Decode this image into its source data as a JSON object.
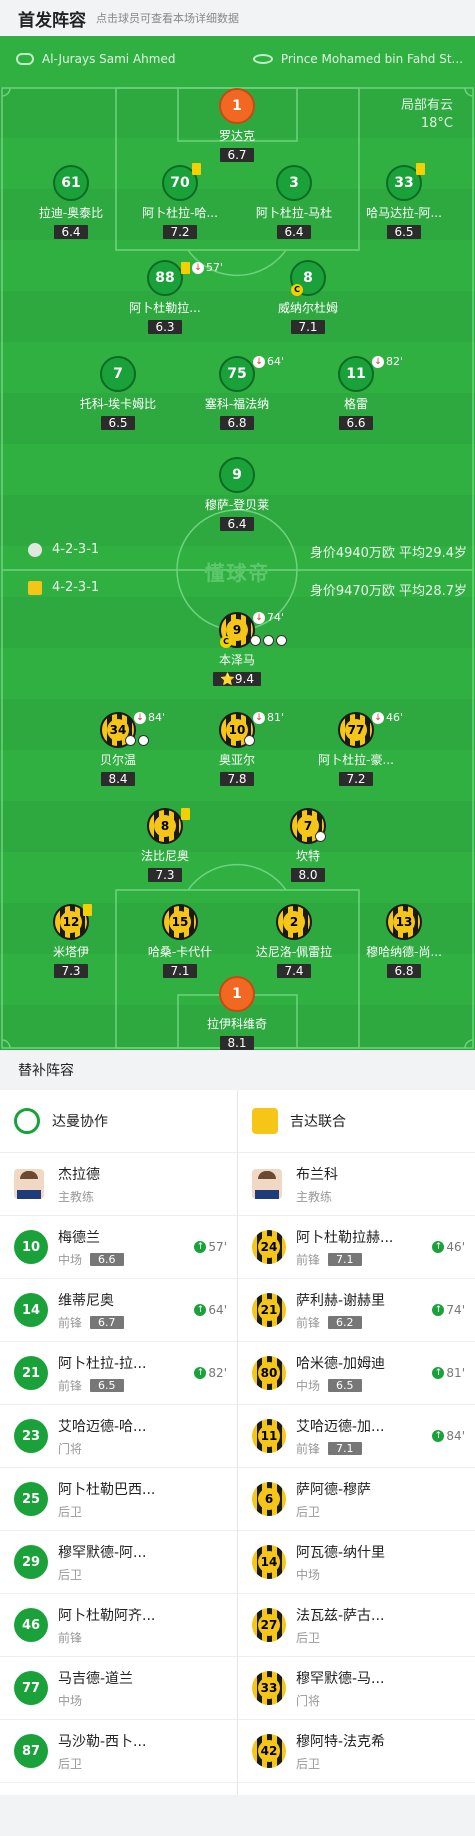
{
  "header": {
    "title": "首发阵容",
    "subtitle": "点击球员可查看本场详细数据"
  },
  "home_team": {
    "name": "Al-Jurays Sami Ahmed",
    "formation": "4-2-3-1",
    "value_text": "身价4940万欧 平均29.4岁"
  },
  "away_team": {
    "name": "Prince Mohamed bin Fahd St...",
    "formation": "4-2-3-1",
    "value_text": "身价9470万欧 平均28.7岁"
  },
  "weather": {
    "condition": "局部有云",
    "temp": "18°C"
  },
  "watermark": "懂球帝",
  "home_players": [
    {
      "num": "1",
      "name": "罗达克",
      "rating": "6.7"
    },
    {
      "num": "61",
      "name": "拉迪-奥泰比",
      "rating": "6.4"
    },
    {
      "num": "70",
      "name": "阿卜杜拉-哈...",
      "rating": "7.2"
    },
    {
      "num": "3",
      "name": "阿卜杜拉-马杜",
      "rating": "6.4"
    },
    {
      "num": "33",
      "name": "哈马达拉-阿...",
      "rating": "6.5"
    },
    {
      "num": "88",
      "name": "阿卜杜勒拉...",
      "rating": "6.3",
      "sub": "57'"
    },
    {
      "num": "8",
      "name": "威纳尔杜姆",
      "rating": "7.1"
    },
    {
      "num": "7",
      "name": "托科-埃卡姆比",
      "rating": "6.5"
    },
    {
      "num": "75",
      "name": "塞科-福法纳",
      "rating": "6.8",
      "sub": "64'"
    },
    {
      "num": "11",
      "name": "格雷",
      "rating": "6.6",
      "sub": "82'"
    },
    {
      "num": "9",
      "name": "穆萨-登贝莱",
      "rating": "6.4"
    }
  ],
  "away_players": [
    {
      "num": "9",
      "name": "本泽马",
      "rating": "9.4",
      "sub": "74'"
    },
    {
      "num": "34",
      "name": "贝尔温",
      "rating": "8.4",
      "sub": "84'"
    },
    {
      "num": "10",
      "name": "奥亚尔",
      "rating": "7.8",
      "sub": "81'"
    },
    {
      "num": "77",
      "name": "阿卜杜拉-豪...",
      "rating": "7.2",
      "sub": "46'"
    },
    {
      "num": "8",
      "name": "法比尼奥",
      "rating": "7.3"
    },
    {
      "num": "7",
      "name": "坎特",
      "rating": "8.0"
    },
    {
      "num": "12",
      "name": "米塔伊",
      "rating": "7.3"
    },
    {
      "num": "15",
      "name": "哈桑-卡代什",
      "rating": "7.1"
    },
    {
      "num": "2",
      "name": "达尼洛-佩雷拉",
      "rating": "7.4"
    },
    {
      "num": "13",
      "name": "穆哈纳德-尚...",
      "rating": "6.8"
    },
    {
      "num": "1",
      "name": "拉伊科维奇",
      "rating": "8.1"
    }
  ],
  "subs": {
    "title": "替补阵容",
    "home": {
      "team_name": "达曼协作",
      "coach": {
        "name": "杰拉德",
        "role": "主教练"
      },
      "players": [
        {
          "num": "10",
          "name": "梅德兰",
          "pos": "中场",
          "rating": "6.6",
          "min": "57'"
        },
        {
          "num": "14",
          "name": "维蒂尼奥",
          "pos": "前锋",
          "rating": "6.7",
          "min": "64'"
        },
        {
          "num": "21",
          "name": "阿卜杜拉-拉...",
          "pos": "前锋",
          "rating": "6.5",
          "min": "82'"
        },
        {
          "num": "23",
          "name": "艾哈迈德-哈...",
          "pos": "门将"
        },
        {
          "num": "25",
          "name": "阿卜杜勒巴西...",
          "pos": "后卫"
        },
        {
          "num": "29",
          "name": "穆罕默德-阿...",
          "pos": "后卫"
        },
        {
          "num": "46",
          "name": "阿卜杜勒阿齐...",
          "pos": "前锋"
        },
        {
          "num": "77",
          "name": "马吉德-道兰",
          "pos": "中场"
        },
        {
          "num": "87",
          "name": "马沙勒-西卜...",
          "pos": "后卫"
        }
      ]
    },
    "away": {
      "team_name": "吉达联合",
      "coach": {
        "name": "布兰科",
        "role": "主教练"
      },
      "players": [
        {
          "num": "24",
          "name": "阿卜杜勒拉赫...",
          "pos": "前锋",
          "rating": "7.1",
          "min": "46'"
        },
        {
          "num": "21",
          "name": "萨利赫-谢赫里",
          "pos": "前锋",
          "rating": "6.2",
          "min": "74'"
        },
        {
          "num": "80",
          "name": "哈米德-加姆迪",
          "pos": "中场",
          "rating": "6.5",
          "min": "81'"
        },
        {
          "num": "11",
          "name": "艾哈迈德-加...",
          "pos": "前锋",
          "rating": "7.1",
          "min": "84'"
        },
        {
          "num": "6",
          "name": "萨阿德-穆萨",
          "pos": "后卫"
        },
        {
          "num": "14",
          "name": "阿瓦德-纳什里",
          "pos": "中场"
        },
        {
          "num": "27",
          "name": "法瓦兹-萨古...",
          "pos": "后卫"
        },
        {
          "num": "33",
          "name": "穆罕默德-马...",
          "pos": "门将"
        },
        {
          "num": "42",
          "name": "穆阿特-法克希",
          "pos": "后卫"
        }
      ]
    }
  },
  "colors": {
    "pitch": "#31b042",
    "home": "#1aa13a",
    "away_gold": "#f5c518",
    "gk": "#f26722"
  }
}
